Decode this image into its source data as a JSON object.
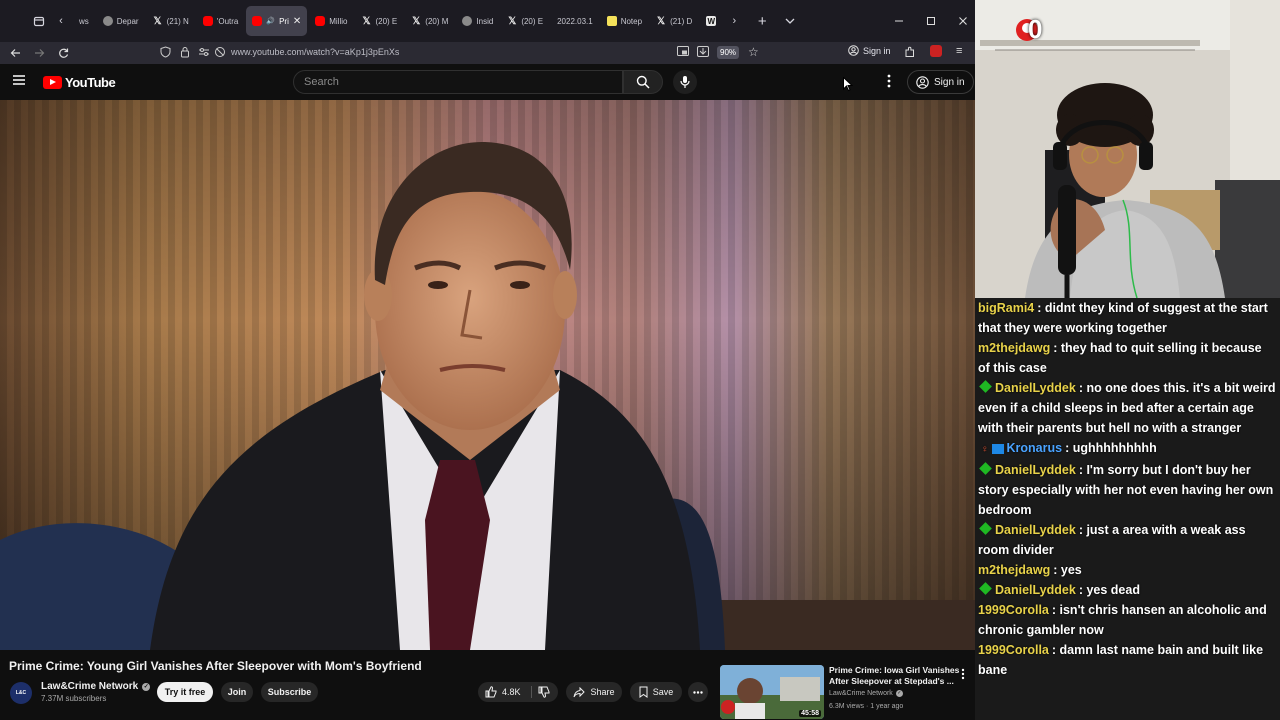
{
  "browser": {
    "tabs": [
      {
        "label": "ws",
        "icon": "none"
      },
      {
        "label": "Depar",
        "icon": "gen"
      },
      {
        "label": "(21) N",
        "icon": "x"
      },
      {
        "label": "'Outra",
        "icon": "yt"
      },
      {
        "label": "Pri",
        "icon": "yt",
        "active": true
      },
      {
        "label": "Millio",
        "icon": "yt"
      },
      {
        "label": "(20) E",
        "icon": "x"
      },
      {
        "label": "(20) M",
        "icon": "x"
      },
      {
        "label": "Insid",
        "icon": "gen"
      },
      {
        "label": "(20) E",
        "icon": "x"
      },
      {
        "label": "2022.03.1",
        "icon": "none"
      },
      {
        "label": "Notep",
        "icon": "note"
      },
      {
        "label": "(21) D",
        "icon": "x"
      },
      {
        "label": "",
        "icon": "w"
      }
    ],
    "url": "www.youtube.com/watch?v=aKp1j3pEnXs",
    "zoom": "90%",
    "sign_in": "Sign in"
  },
  "youtube": {
    "logo_text": "YouTube",
    "search_placeholder": "Search",
    "sign_in": "Sign in",
    "video_title": "Prime Crime: Young Girl Vanishes After Sleepover with Mom's Boyfriend",
    "channel_name": "Law&Crime Network",
    "subscribers": "7.37M subscribers",
    "try_free": "Try it free",
    "join": "Join",
    "subscribe": "Subscribe",
    "likes": "4.8K",
    "share": "Share",
    "save": "Save",
    "recommendation": {
      "title_line1": "Prime Crime: Iowa Girl Vanishes",
      "title_line2": "After Sleepover at Stepdad's ...",
      "channel": "Law&Crime Network",
      "meta": "6.3M views · 1 year ago",
      "duration": "45:58"
    }
  },
  "stream": {
    "badge_count": "0",
    "chat": [
      {
        "user": "bigRami4",
        "color": "#e8d24a",
        "badge": "none",
        "text": ": didnt they kind of suggest at the start that they were working together"
      },
      {
        "user": "m2thejdawg",
        "color": "#e8d24a",
        "badge": "none",
        "text": ": they had to quit selling it because of this case"
      },
      {
        "user": "DanielLyddek",
        "color": "#e8d24a",
        "badge": "diamond",
        "text": ": no one does this. it's a bit weird even if a child sleeps in bed after a certain age with their parents but hell no with a stranger"
      },
      {
        "user": "Kronarus",
        "color": "#4aa3ff",
        "badge": "sub",
        "text": ": ughhhhhhhhh"
      },
      {
        "user": "DanielLyddek",
        "color": "#e8d24a",
        "badge": "diamond",
        "text": ": I'm sorry but I don't buy her story especially with her not even having her own bedroom"
      },
      {
        "user": "DanielLyddek",
        "color": "#e8d24a",
        "badge": "diamond",
        "text": ": just a area with a weak ass room divider"
      },
      {
        "user": "m2thejdawg",
        "color": "#e8d24a",
        "badge": "none",
        "text": ": yes"
      },
      {
        "user": "DanielLyddek",
        "color": "#e8d24a",
        "badge": "diamond",
        "text": ": yes dead"
      },
      {
        "user": "1999Corolla",
        "color": "#e8d24a",
        "badge": "none",
        "text": ": isn't chris hansen an alcoholic and chronic gambler now"
      },
      {
        "user": "1999Corolla",
        "color": "#e8d24a",
        "badge": "none",
        "text": ": damn last name bain and built like bane"
      }
    ]
  }
}
